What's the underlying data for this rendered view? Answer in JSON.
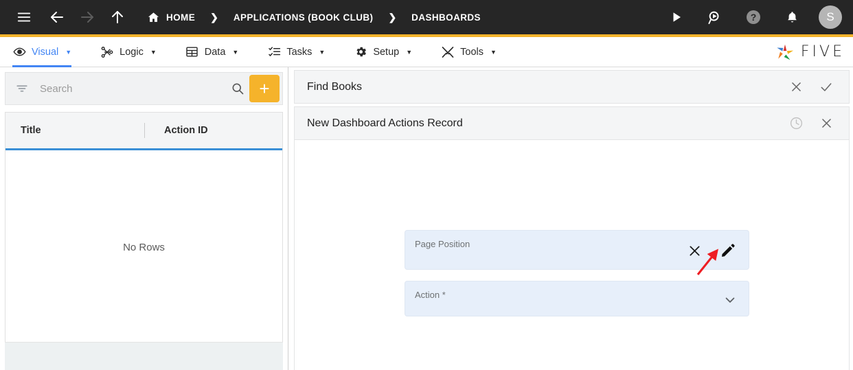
{
  "topbar": {
    "menu_icon": "hamburger-icon",
    "back_icon": "arrow-left-icon",
    "forward_icon": "arrow-right-icon",
    "up_icon": "arrow-up-icon",
    "home_label": "HOME",
    "separator": "❯",
    "breadcrumbs": [
      {
        "label": "APPLICATIONS (BOOK CLUB)"
      },
      {
        "label": "DASHBOARDS"
      }
    ],
    "run_icon": "play-icon",
    "search_run_icon": "search-play-icon",
    "help_icon": "help-circle-icon",
    "notifications_icon": "bell-icon",
    "avatar_initial": "S",
    "bg_color": "#262626",
    "accent_rule_color": "#f5b32b"
  },
  "menubar": {
    "items": [
      {
        "label": "Visual",
        "icon": "eye-icon",
        "active": true,
        "caret": "▼"
      },
      {
        "label": "Logic",
        "icon": "logic-icon",
        "active": false,
        "caret": "▼"
      },
      {
        "label": "Data",
        "icon": "grid-icon",
        "active": false,
        "caret": "▼"
      },
      {
        "label": "Tasks",
        "icon": "tasks-icon",
        "active": false,
        "caret": "▼"
      },
      {
        "label": "Setup",
        "icon": "gear-icon",
        "active": false,
        "caret": "▼"
      },
      {
        "label": "Tools",
        "icon": "tools-icon",
        "active": false,
        "caret": "▼"
      }
    ],
    "brand_text": "FIVE",
    "brand_icon": "five-pinwheel-logo",
    "active_color": "#4285f4"
  },
  "sidebar": {
    "filter_icon": "filter-icon",
    "search_placeholder": "Search",
    "search_value": "",
    "search_icon": "magnifier-icon",
    "add_button_label": "+",
    "add_button_color": "#f5b32b",
    "grid": {
      "columns": [
        "Title",
        "Action ID"
      ],
      "rows": [],
      "empty_message": "No Rows",
      "header_underline_color": "#3a8fd6"
    }
  },
  "main": {
    "record_header": {
      "title": "Find Books",
      "close_icon": "close-icon",
      "confirm_icon": "check-icon"
    },
    "form_header": {
      "title": "New Dashboard Actions Record",
      "history_icon": "clock-icon",
      "close_icon": "close-icon"
    },
    "fields": [
      {
        "name": "page-position",
        "label": "Page Position",
        "value": "",
        "icons": [
          "close-icon",
          "pencil-icon"
        ]
      },
      {
        "name": "action",
        "label": "Action *",
        "value": "",
        "icons": [
          "chevron-down-icon"
        ]
      }
    ],
    "annotation": {
      "type": "red-arrow",
      "color": "#ee1d23",
      "points_to": "pencil-icon"
    }
  }
}
